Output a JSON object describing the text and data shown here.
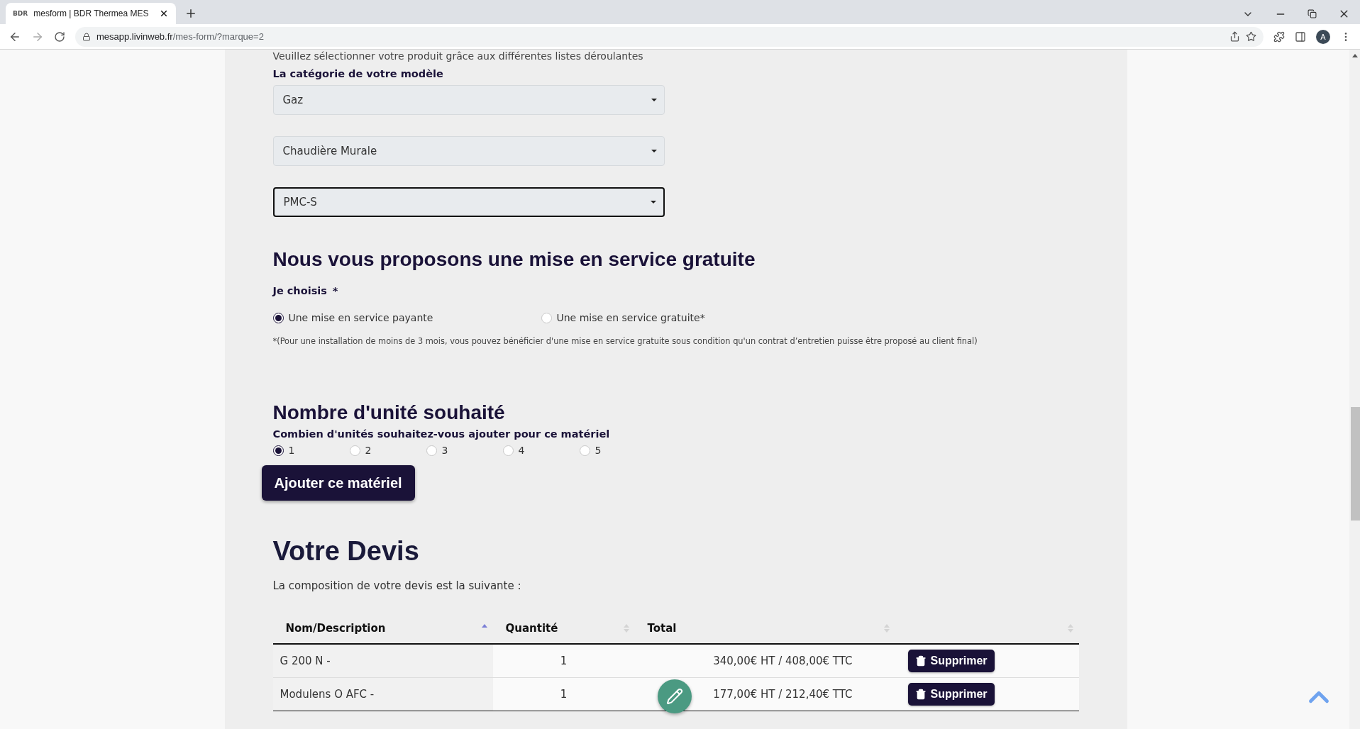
{
  "browser": {
    "tab": {
      "favicon_text": "BDR",
      "title": "mesform | BDR Thermea MES"
    },
    "url_host": "mesapp.livinweb.fr",
    "url_path": "/mes-form/?marque=2",
    "avatar": "A"
  },
  "form": {
    "intro": "Veuillez sélectionner votre produit grâce aux différentes listes déroulantes",
    "category_label": "La catégorie de votre modèle",
    "selects": [
      {
        "value": "Gaz",
        "focused": false
      },
      {
        "value": "Chaudière Murale",
        "focused": false
      },
      {
        "value": "PMC-S",
        "focused": true
      }
    ],
    "service": {
      "heading": "Nous vous proposons une mise en service gratuite",
      "label": "Je choisis",
      "required": "*",
      "options": [
        {
          "label": "Une mise en service payante",
          "selected": true
        },
        {
          "label": "Une mise en service gratuite*",
          "selected": false
        }
      ],
      "footnote": "*(Pour une installation de moins de 3 mois, vous pouvez bénéficier d'une mise en service gratuite sous condition qu'un contrat d’entretien puisse être proposé au client final)"
    },
    "units": {
      "heading": "Nombre d'unité souhaité",
      "question": "Combien d'unités souhaitez-vous ajouter pour ce matériel",
      "options": [
        {
          "label": "1",
          "selected": true
        },
        {
          "label": "2",
          "selected": false
        },
        {
          "label": "3",
          "selected": false
        },
        {
          "label": "4",
          "selected": false
        },
        {
          "label": "5",
          "selected": false
        }
      ],
      "add_button": "Ajouter ce matériel"
    }
  },
  "quote": {
    "heading": "Votre Devis",
    "intro": "La composition de votre devis est la suivante :",
    "columns": [
      {
        "label": "Nom/Description",
        "sorted": true
      },
      {
        "label": "Quantité",
        "sorted": false
      },
      {
        "label": "Total",
        "sorted": false
      },
      {
        "sorted": false
      }
    ],
    "rows": [
      {
        "name": "G 200 N -",
        "quantity": "1",
        "total": "340,00€ HT / 408,00€ TTC",
        "action": "Supprimer"
      },
      {
        "name": "Modulens O AFC -",
        "quantity": "1",
        "total": "177,00€ HT / 212,40€ TTC",
        "action": "Supprimer"
      }
    ]
  }
}
